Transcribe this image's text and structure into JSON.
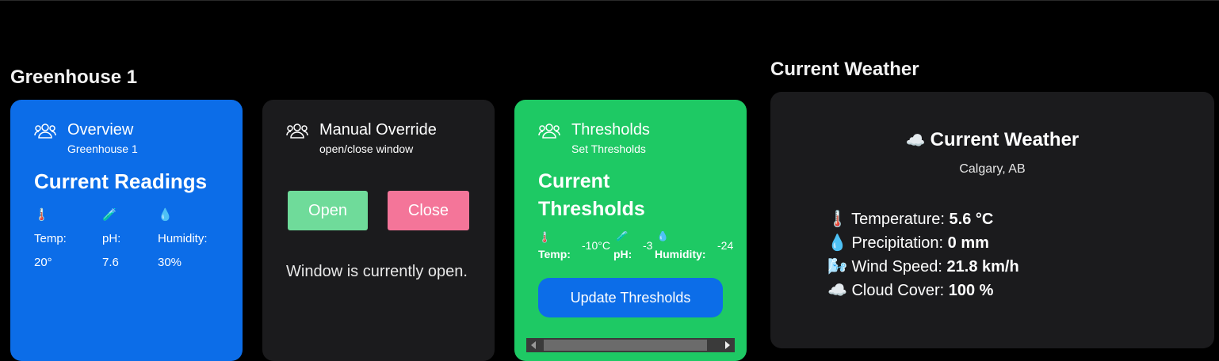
{
  "greenhouse": {
    "section_title": "Greenhouse 1"
  },
  "overview": {
    "title": "Overview",
    "subtitle": "Greenhouse 1",
    "readings_title": "Current Readings",
    "readings": [
      {
        "icon": "🌡️",
        "icon_name": "thermometer-icon",
        "label": "Temp:",
        "value": "20°"
      },
      {
        "icon": "🧪",
        "icon_name": "test-tube-icon",
        "label": "pH:",
        "value": "7.6"
      },
      {
        "icon": "💧",
        "icon_name": "droplet-icon",
        "label": "Humidity:",
        "value": "30%"
      }
    ],
    "bg": "#0c6de8"
  },
  "override": {
    "title": "Manual Override",
    "subtitle": "open/close window",
    "open_label": "Open",
    "close_label": "Close",
    "status": "Window is currently open.",
    "open_color": "#6fdb9a",
    "close_color": "#f47599"
  },
  "thresholds": {
    "title": "Thresholds",
    "subtitle": "Set Thresholds",
    "heading": "Current Thresholds",
    "items": [
      {
        "icon": "🌡️",
        "label": "Temp:",
        "value": "-10°C"
      },
      {
        "icon": "🧪",
        "label": "pH:",
        "value": "-3"
      },
      {
        "icon": "💧",
        "label": "Humidity:",
        "value": "-24"
      }
    ],
    "update_label": "Update Thresholds",
    "bg": "#1ec964"
  },
  "weather": {
    "section_title": "Current Weather",
    "card_title": "Current Weather",
    "title_icon": "☁️",
    "location": "Calgary, AB",
    "rows": [
      {
        "icon": "🌡️",
        "icon_name": "thermometer-icon",
        "label": "Temperature:",
        "value": "5.6 °C"
      },
      {
        "icon": "💧",
        "icon_name": "droplet-icon",
        "label": "Precipitation:",
        "value": "0 mm"
      },
      {
        "icon": "🌬️",
        "icon_name": "wind-icon",
        "label": "Wind Speed:",
        "value": "21.8 km/h"
      },
      {
        "icon": "☁️",
        "icon_name": "cloud-icon",
        "label": "Cloud Cover:",
        "value": "100 %"
      }
    ]
  }
}
